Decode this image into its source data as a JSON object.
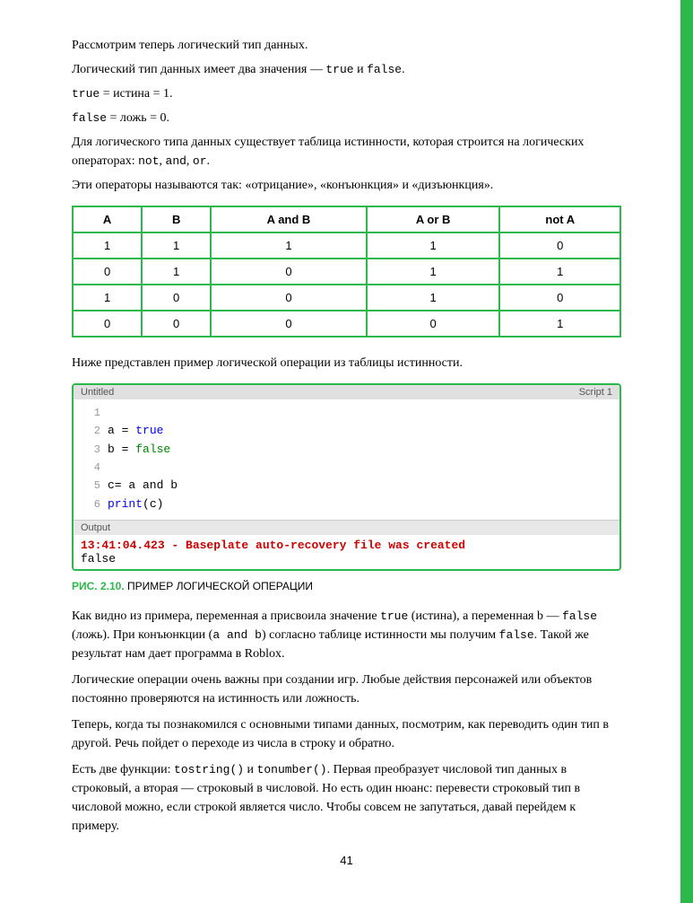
{
  "page": {
    "number": "41",
    "paragraphs": [
      "Рассмотрим теперь логический тип данных.",
      "Логический тип данных имеет два значения — true и false.",
      "true = истина = 1.",
      "false = ложь = 0.",
      "Для логического типа данных существует таблица истинности, которая строится на логических операторах: not, and, or.",
      "Эти операторы называются так: «отрицание», «конъюнкция» и «дизъюнкция»."
    ],
    "table": {
      "headers": [
        "A",
        "B",
        "A and B",
        "A or B",
        "not A"
      ],
      "rows": [
        [
          "1",
          "1",
          "1",
          "1",
          "0"
        ],
        [
          "0",
          "1",
          "0",
          "1",
          "1"
        ],
        [
          "1",
          "0",
          "0",
          "1",
          "0"
        ],
        [
          "0",
          "0",
          "0",
          "0",
          "1"
        ]
      ]
    },
    "code_caption": "Ниже представлен пример логической операции из таблицы истинности.",
    "code_header_left": "Untitled",
    "code_header_right": "Script 1",
    "code_lines": [
      {
        "num": "1",
        "text": "",
        "parts": []
      },
      {
        "num": "2",
        "text": "a = true",
        "parts": [
          {
            "t": "a = ",
            "c": ""
          },
          {
            "t": "true",
            "c": "blue"
          }
        ]
      },
      {
        "num": "3",
        "text": "b = false",
        "parts": [
          {
            "t": "b = ",
            "c": ""
          },
          {
            "t": "false",
            "c": "green"
          }
        ]
      },
      {
        "num": "4",
        "text": "",
        "parts": []
      },
      {
        "num": "5",
        "text": "c= a and b",
        "parts": [
          {
            "t": "c= a and b",
            "c": ""
          }
        ]
      },
      {
        "num": "6",
        "text": "print(c)",
        "parts": [
          {
            "t": "print",
            "c": "blue"
          },
          {
            "t": "(c)",
            "c": ""
          }
        ]
      }
    ],
    "output_label": "Output",
    "output_timestamp": "13:41:04.423 - Baseplate auto-recovery file was created",
    "output_result": "false",
    "fig_label": "РИС. 2.10.",
    "fig_title": "ПРИМЕР ЛОГИЧЕСКОЙ ОПЕРАЦИИ",
    "body_paragraphs": [
      "Как видно из примера, переменная a присвоила значение true (истина), а переменная b — false (ложь). При конъюнкции (a and b) согласно таблице истинности мы получим false. Такой же результат нам дает программа в Roblox.",
      "Логические операции очень важны при создании игр. Любые действия персонажей или объектов постоянно проверяются на истинность или ложность.",
      "Теперь, когда ты познакомился с основными типами данных, посмотрим, как переводить один тип в другой. Речь пойдет о переходе из числа в строку и обратно.",
      "Есть две функции: tostring() и tonumber(). Первая преобразует числовой тип данных в строковый, а вторая — строковый в числовой. Но есть один нюанс: перевести строковый тип в числовой можно, если строкой является число. Чтобы совсем не запутаться, давай перейдем к примеру."
    ]
  }
}
